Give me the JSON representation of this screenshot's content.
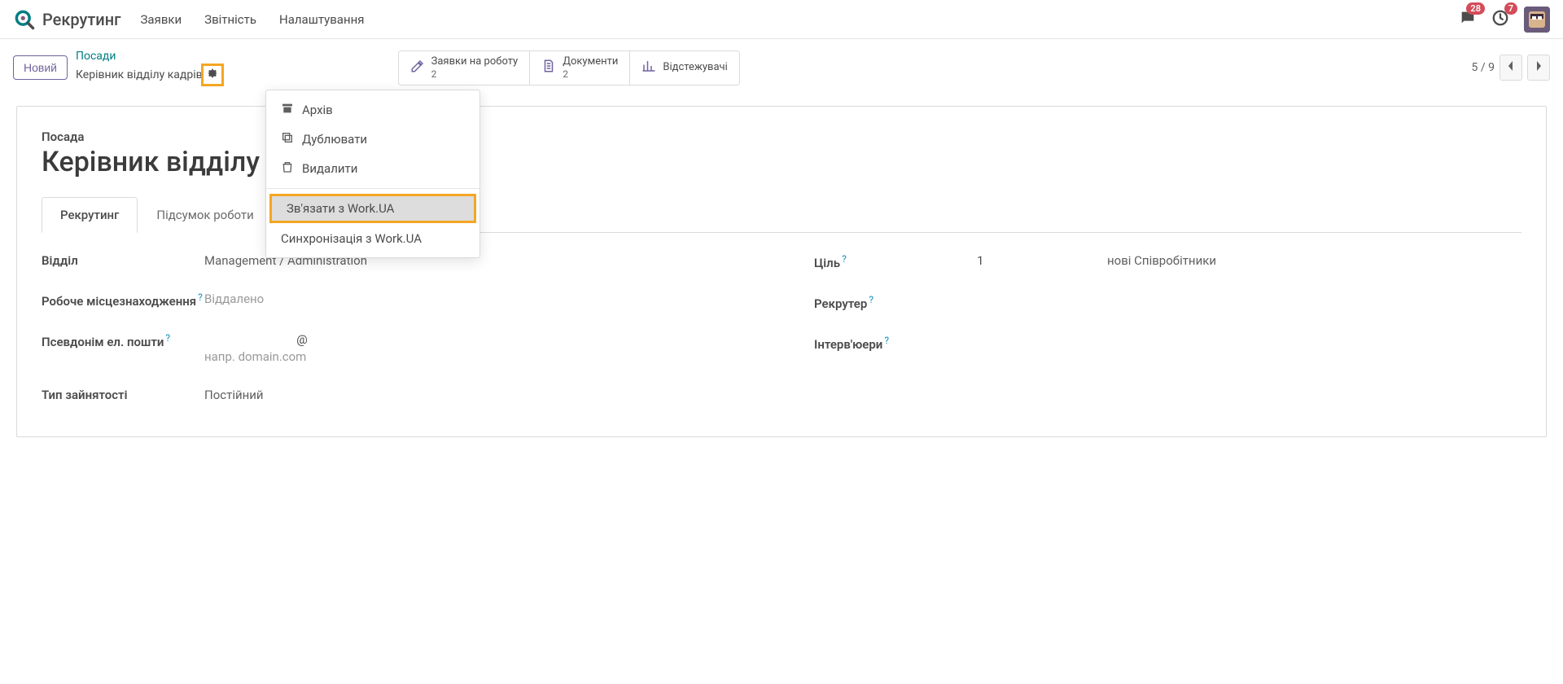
{
  "nav": {
    "app_title": "Рекрутинг",
    "items": [
      "Заявки",
      "Звітність",
      "Налаштування"
    ],
    "messages_badge": "28",
    "activities_badge": "7"
  },
  "controlbar": {
    "new_btn": "Новий",
    "breadcrumb_root": "Посади",
    "breadcrumb_current": "Керівник відділу кадрів",
    "stats": {
      "applications_label": "Заявки на роботу",
      "applications_count": "2",
      "documents_label": "Документи",
      "documents_count": "2",
      "trackers_label": "Відстежувачі"
    },
    "pager": {
      "pos": "5",
      "sep": "/",
      "total": "9"
    }
  },
  "gear_menu": {
    "archive": "Архів",
    "duplicate": "Дублювати",
    "delete": "Видалити",
    "link_workua": "Зв'язати з Work.UA",
    "sync_workua": "Синхронізація з Work.UA"
  },
  "record": {
    "title_label": "Посада",
    "title": "Керівник відділу кадрів",
    "tabs": {
      "recruiting": "Рекрутинг",
      "work_summary": "Підсумок роботи"
    },
    "fields": {
      "department_label": "Відділ",
      "department_value": "Management / Administration",
      "worklocation_label": "Робоче місцезнаходження",
      "worklocation_value": "Віддалено",
      "emailalias_label": "Псевдонім ел. пошти",
      "email_at": "@",
      "email_domain_placeholder": "напр. domain.com",
      "employment_label": "Тип зайнятості",
      "employment_value": "Постійний",
      "target_label": "Ціль",
      "target_value": "1",
      "target_suffix": "нові Співробітники",
      "recruiter_label": "Рекрутер",
      "interviewers_label": "Інтерв'юери"
    }
  }
}
